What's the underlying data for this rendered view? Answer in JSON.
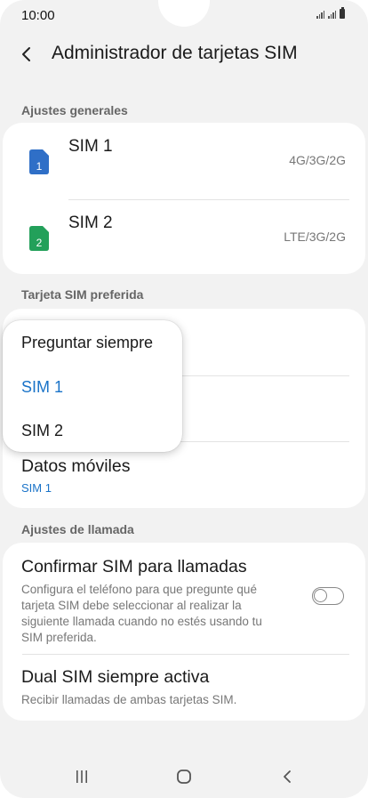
{
  "status_bar": {
    "time": "10:00"
  },
  "header": {
    "title": "Administrador de tarjetas SIM"
  },
  "sections": {
    "general": "Ajustes generales",
    "preferred": "Tarjeta SIM preferida",
    "calls": "Ajustes de llamada"
  },
  "sims": [
    {
      "name": "SIM 1",
      "number": "1",
      "tech": "4G/3G/2G",
      "color": "#2f6fc7"
    },
    {
      "name": "SIM 2",
      "number": "2",
      "tech": "LTE/3G/2G",
      "color": "#23a05a"
    }
  ],
  "preferred": {
    "mobile_data_label": "Datos móviles",
    "mobile_data_value": "SIM 1"
  },
  "dropdown": {
    "options": [
      "Preguntar siempre",
      "SIM 1",
      "SIM 2"
    ],
    "selected": "SIM 1"
  },
  "call_settings": {
    "confirm_title": "Confirmar SIM para llamadas",
    "confirm_desc_lines": [
      "Configura el teléfono para que pregunte qué",
      "tarjeta SIM debe seleccionar al realizar la",
      "siguiente llamada cuando no estés usando tu",
      "SIM preferida."
    ],
    "confirm_enabled": false,
    "dual_title": "Dual SIM siempre activa",
    "dual_desc": "Recibir llamadas de ambas tarjetas SIM."
  },
  "colors": {
    "accent": "#1a73c8",
    "background": "#f2f2f2"
  }
}
